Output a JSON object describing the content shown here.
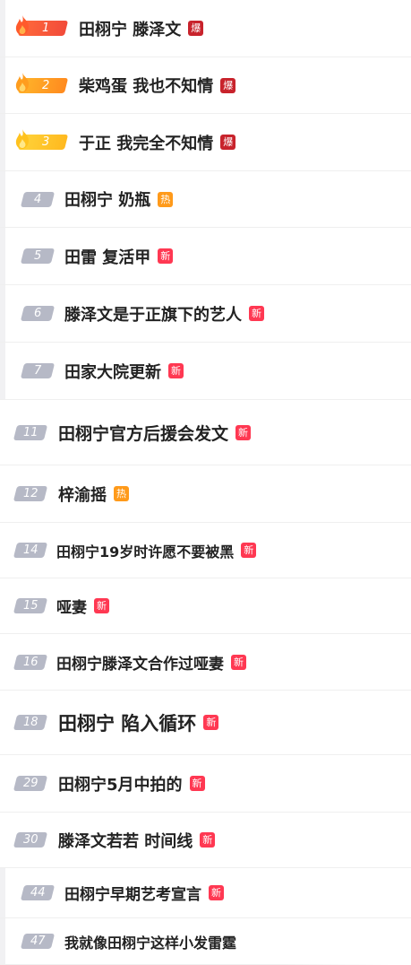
{
  "colors": {
    "rank_plain": "#b6b9c6",
    "rank_1": "#f24b3a",
    "rank_2": "#ff8a1f",
    "rank_3": "#ffb91f",
    "badge_bao": "#c8232c",
    "badge_re": "#ff9a1a",
    "badge_xin": "#ff3852",
    "title_text": "#222222"
  },
  "trending": [
    {
      "rank": "1",
      "title": "田栩宁 滕泽文",
      "badge": "爆",
      "badge_type": "bao",
      "style": "top1"
    },
    {
      "rank": "2",
      "title": "柴鸡蛋 我也不知情",
      "badge": "爆",
      "badge_type": "bao",
      "style": "top2"
    },
    {
      "rank": "3",
      "title": "于正 我完全不知情",
      "badge": "爆",
      "badge_type": "bao",
      "style": "top3"
    },
    {
      "rank": "4",
      "title": "田栩宁 奶瓶",
      "badge": "热",
      "badge_type": "re",
      "style": "plain"
    },
    {
      "rank": "5",
      "title": "田雷 复活甲",
      "badge": "新",
      "badge_type": "xin",
      "style": "plain"
    },
    {
      "rank": "6",
      "title": "滕泽文是于正旗下的艺人",
      "badge": "新",
      "badge_type": "xin",
      "style": "plain"
    },
    {
      "rank": "7",
      "title": "田家大院更新",
      "badge": "新",
      "badge_type": "xin",
      "style": "plain"
    },
    {
      "rank": "11",
      "title": "田栩宁官方后援会发文",
      "badge": "新",
      "badge_type": "xin",
      "style": "plain"
    },
    {
      "rank": "12",
      "title": "梓渝摇",
      "badge": "热",
      "badge_type": "re",
      "style": "plain"
    },
    {
      "rank": "14",
      "title": "田栩宁19岁时许愿不要被黑",
      "badge": "新",
      "badge_type": "xin",
      "style": "plain"
    },
    {
      "rank": "15",
      "title": "哑妻",
      "badge": "新",
      "badge_type": "xin",
      "style": "plain"
    },
    {
      "rank": "16",
      "title": "田栩宁滕泽文合作过哑妻",
      "badge": "新",
      "badge_type": "xin",
      "style": "plain"
    },
    {
      "rank": "18",
      "title": "田栩宁 陷入循环",
      "badge": "新",
      "badge_type": "xin",
      "style": "plain"
    },
    {
      "rank": "29",
      "title": "田栩宁5月中拍的",
      "badge": "新",
      "badge_type": "xin",
      "style": "plain"
    },
    {
      "rank": "30",
      "title": "滕泽文若若 时间线",
      "badge": "新",
      "badge_type": "xin",
      "style": "plain"
    },
    {
      "rank": "44",
      "title": "田栩宁早期艺考宣言",
      "badge": "新",
      "badge_type": "xin",
      "style": "plain"
    },
    {
      "rank": "47",
      "title": "我就像田栩宁这样小发雷霆",
      "badge": "",
      "badge_type": "",
      "style": "plain"
    }
  ]
}
